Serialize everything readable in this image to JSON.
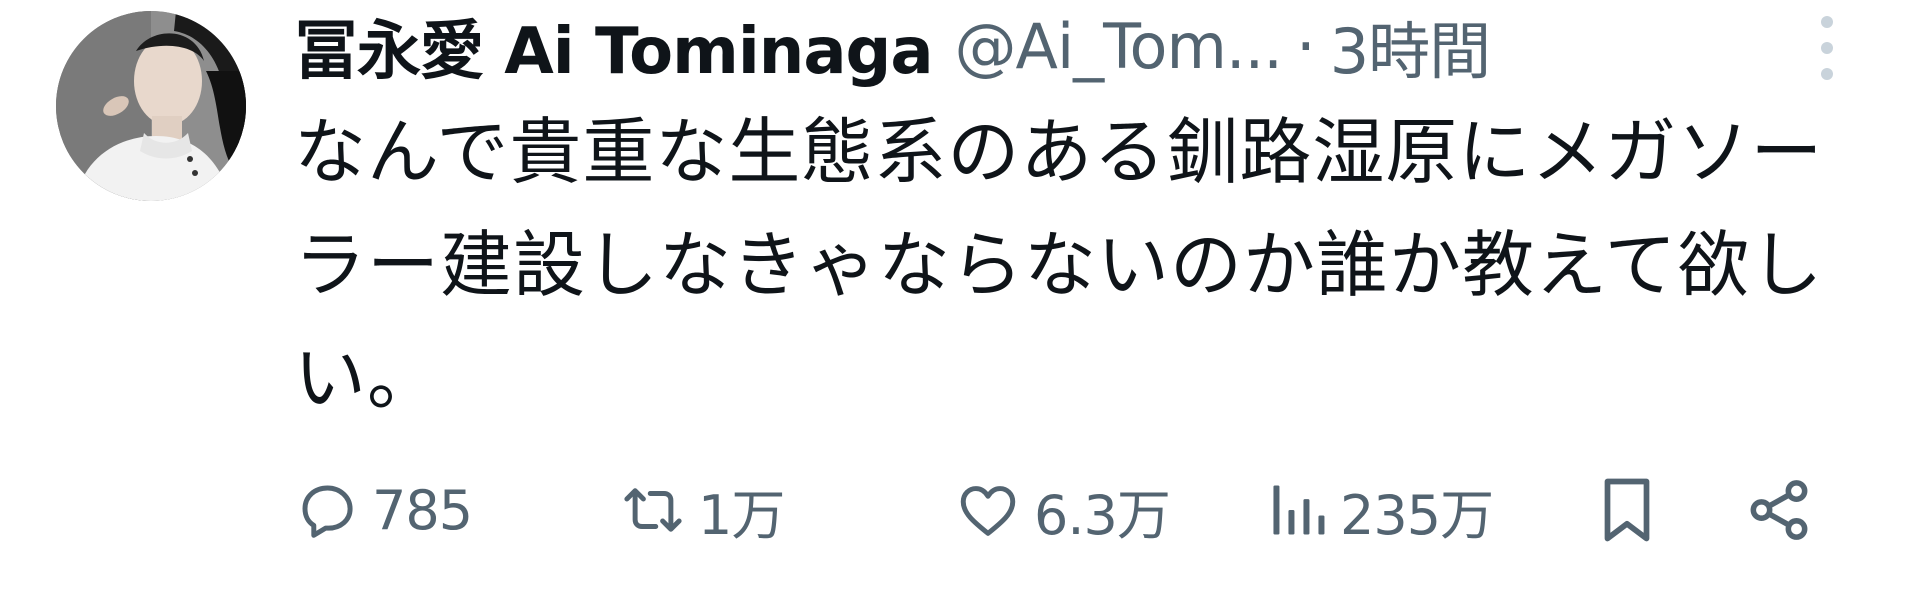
{
  "tweet": {
    "display_name": "冨永愛 Ai Tominaga",
    "handle": "@Ai_Tom...",
    "separator": "·",
    "time": "3時間",
    "text": "なんで貴重な生態系のある釧路湿原にメガソーラー建設しなきゃならないのか誰か教えて欲しい。"
  },
  "actions": {
    "reply": {
      "icon": "reply-icon",
      "count": "785"
    },
    "retweet": {
      "icon": "retweet-icon",
      "count": "1万"
    },
    "like": {
      "icon": "heart-icon",
      "count": "6.3万"
    },
    "views": {
      "icon": "views-bar-chart-icon",
      "count": "235万"
    },
    "bookmark": {
      "icon": "bookmark-icon"
    },
    "share": {
      "icon": "share-icon"
    }
  },
  "colors": {
    "text": "#0f1419",
    "secondary": "#536471",
    "more_dots": "#c9d3db",
    "background": "#ffffff"
  }
}
